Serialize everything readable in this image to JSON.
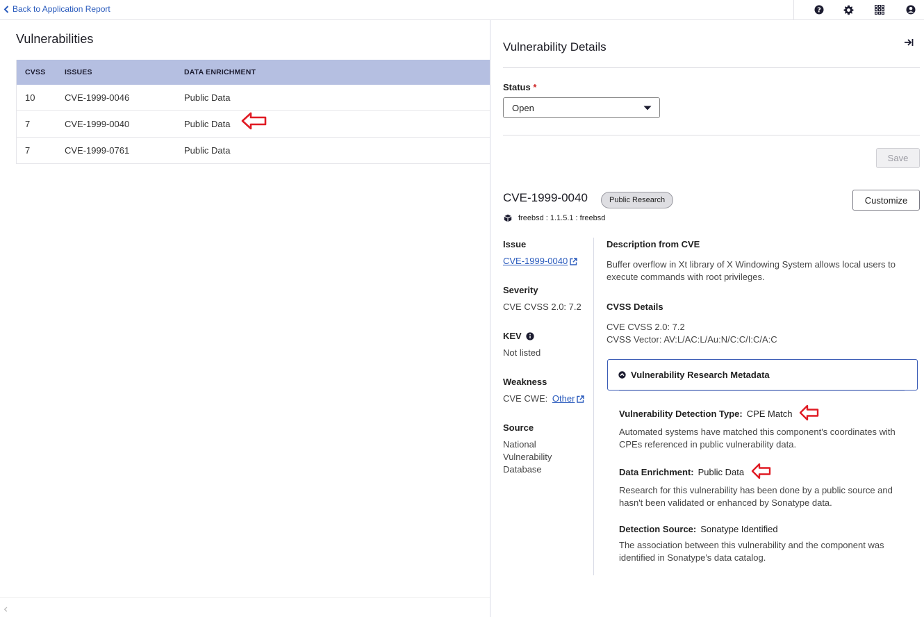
{
  "topbar": {
    "back_label": "Back to Application Report"
  },
  "left": {
    "title": "Vulnerabilities",
    "columns": [
      "CVSS",
      "ISSUES",
      "DATA ENRICHMENT"
    ],
    "rows": [
      {
        "cvss": "10",
        "issue": "CVE-1999-0046",
        "enrichment": "Public Data"
      },
      {
        "cvss": "7",
        "issue": "CVE-1999-0040",
        "enrichment": "Public Data"
      },
      {
        "cvss": "7",
        "issue": "CVE-1999-0761",
        "enrichment": "Public Data"
      }
    ]
  },
  "details": {
    "title": "Vulnerability Details",
    "status_label": "Status",
    "status_required": "*",
    "status_value": "Open",
    "save_label": "Save",
    "cve_id": "CVE-1999-0040",
    "badge": "Public Research",
    "customize_label": "Customize",
    "coordinates": "freebsd : 1.1.5.1 : freebsd",
    "issue_heading": "Issue",
    "issue_link": "CVE-1999-0040",
    "severity_heading": "Severity",
    "severity_value": "CVE CVSS 2.0:  7.2",
    "kev_heading": "KEV",
    "kev_value": "Not listed",
    "weakness_heading": "Weakness",
    "weakness_prefix": "CVE CWE:",
    "weakness_link": "Other",
    "source_heading": "Source",
    "source_value": "National Vulnerability Database",
    "description_heading": "Description from CVE",
    "description_text": "Buffer overflow in Xt library of X Windowing System allows local users to execute commands with root privileges.",
    "cvss_heading": "CVSS Details",
    "cvss_line1": "CVE CVSS 2.0:  7.2",
    "cvss_line2": "CVSS Vector:  AV:L/AC:L/Au:N/C:C/I:C/A:C",
    "metadata_label": "Vulnerability Research Metadata",
    "detection_type_label": "Vulnerability Detection Type:",
    "detection_type_value": "CPE Match",
    "detection_type_desc": "Automated systems have matched this component's coordinates with CPEs referenced in public vulnerability data.",
    "enrichment_label": "Data Enrichment:",
    "enrichment_value": "Public Data",
    "enrichment_desc": "Research for this vulnerability has been done by a public source and hasn't been validated or enhanced by Sonatype data.",
    "detection_source_label": "Detection Source:",
    "detection_source_value": "Sonatype Identified",
    "detection_source_desc": "The association between this vulnerability and the component was identified in Sonatype's data catalog."
  },
  "colors": {
    "accent": "#2a5bbd",
    "table_header": "#b5bfe1",
    "arrow": "#e01b24",
    "box_border": "#3a5bb5"
  },
  "icons": [
    "chevron-left-icon",
    "help-icon",
    "gear-icon",
    "grid-icon",
    "user-icon",
    "collapse-panel-icon",
    "caret-down-icon",
    "package-icon",
    "external-link-icon",
    "info-icon",
    "chevron-up-icon",
    "arrow-left-annotation-icon"
  ]
}
